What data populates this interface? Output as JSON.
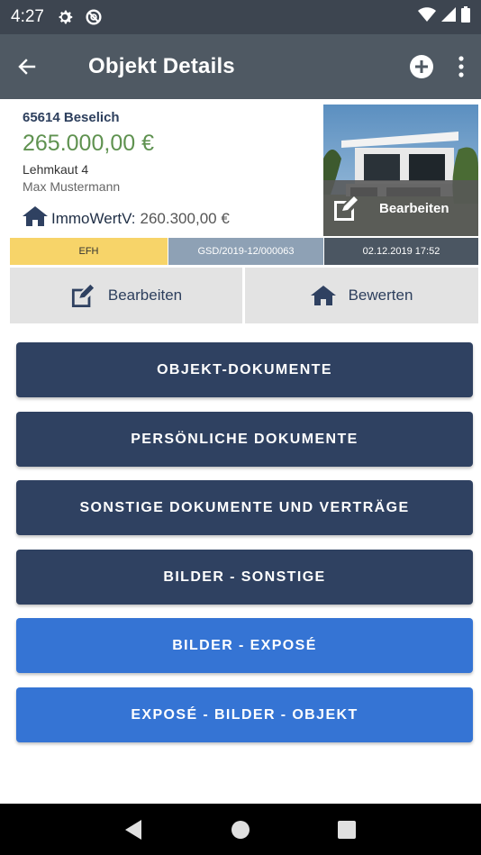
{
  "status_bar": {
    "time": "4:27",
    "icons": [
      "gear-icon",
      "sync-icon",
      "wifi-icon",
      "signal-icon",
      "battery-icon"
    ]
  },
  "app_bar": {
    "title": "Objekt Details",
    "back_icon": "arrow-left-icon",
    "add_icon": "plus-circle-icon",
    "menu_icon": "more-vertical-icon"
  },
  "property": {
    "location": "65614 Beselich",
    "price": "265.000,00 €",
    "street": "Lehmkaut 4",
    "owner": "Max Mustermann",
    "immowertv_label": "ImmoWertV:",
    "immowertv_value": "260.300,00 €",
    "photo_edit_label": "Bearbeiten"
  },
  "tags": {
    "type": "EFH",
    "reference": "GSD/2019-12/000063",
    "date": "02.12.2019 17:52"
  },
  "actions": {
    "edit_label": "Bearbeiten",
    "rate_label": "Bewerten"
  },
  "document_buttons": [
    {
      "label": "OBJEKT-DOKUMENTE"
    },
    {
      "label": "PERSÖNLICHE DOKUMENTE"
    },
    {
      "label": "SONSTIGE DOKUMENTE UND VERTRÄGE"
    },
    {
      "label": "BILDER - SONSTIGE"
    },
    {
      "label": "BILDER - EXPOSÉ"
    },
    {
      "label": "EXPOSÉ - BILDER - OBJEKT"
    }
  ],
  "colors": {
    "dark_button": "#2f4161",
    "blue_button": "#3574d4",
    "price_green": "#5f9250",
    "tag_yellow": "#f7d469"
  },
  "nav_bar": {
    "icons": [
      "back-triangle-icon",
      "home-circle-icon",
      "recents-square-icon"
    ]
  }
}
